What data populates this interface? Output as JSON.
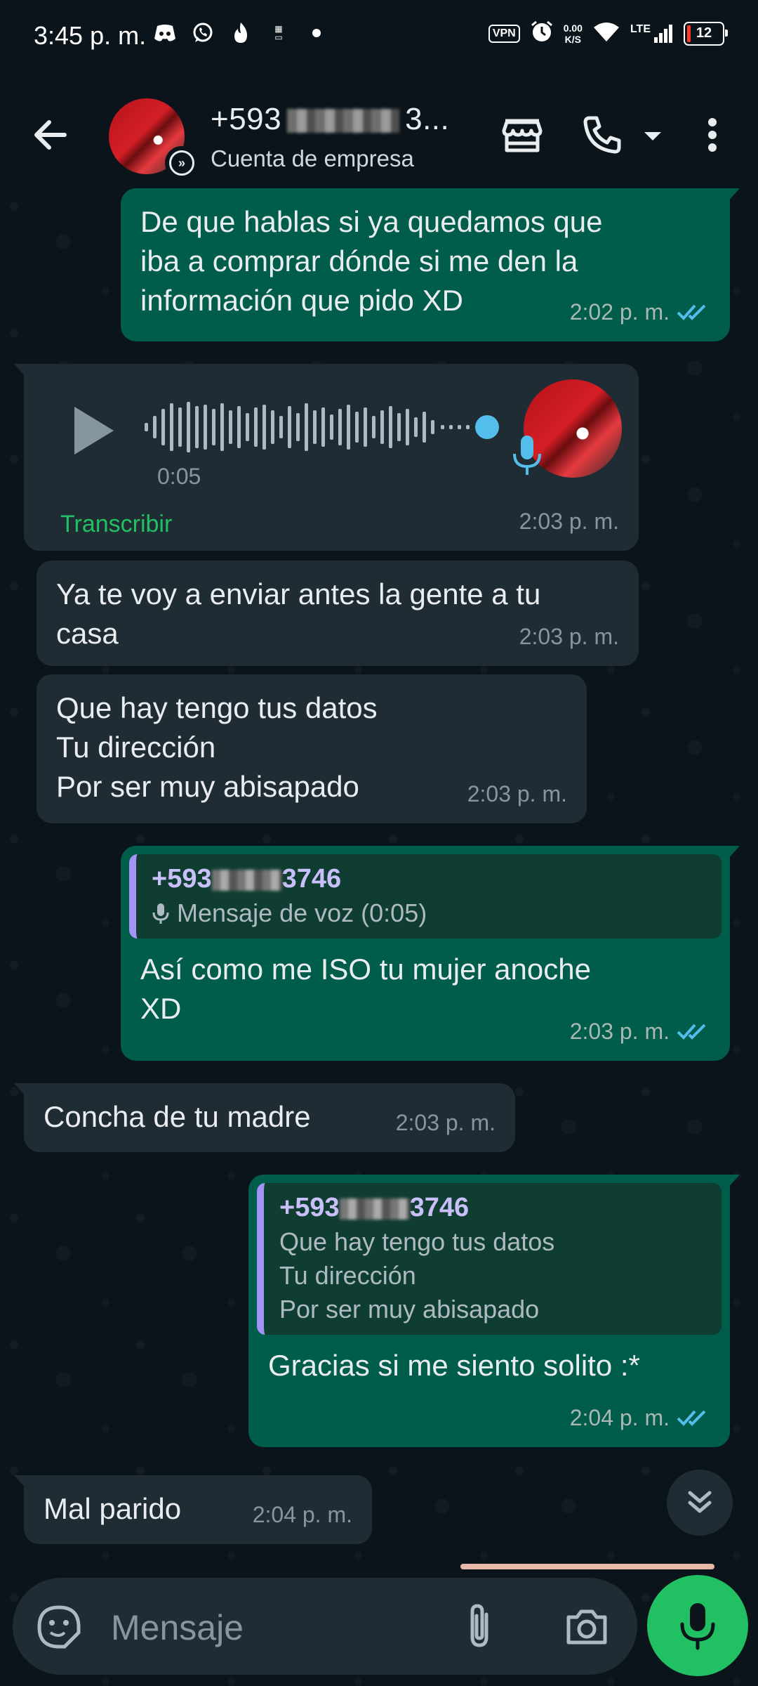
{
  "status_bar": {
    "time": "3:45 p. m.",
    "left_icons": [
      "discord-icon",
      "whatsapp-icon",
      "flame-icon",
      "temu-icon",
      "dot-icon"
    ],
    "vpn": "VPN",
    "speed_value": "0.00",
    "speed_unit": "K/S",
    "network": "LTE",
    "battery": "12"
  },
  "header": {
    "contact_name_prefix": "+593",
    "contact_name_suffix": "3...",
    "subtitle": "Cuenta de empresa"
  },
  "messages": [
    {
      "id": "m1",
      "direction": "out",
      "text_lines": [
        "De que hablas si ya quedamos que",
        "iba a comprar dónde si me den la",
        "información que pido XD"
      ],
      "time": "2:02 p. m.",
      "read": true
    },
    {
      "id": "m2",
      "direction": "in",
      "type": "voice",
      "duration": "0:05",
      "transcribe_label": "Transcribir",
      "time": "2:03 p. m."
    },
    {
      "id": "m3",
      "direction": "in",
      "text_lines": [
        "Ya te voy a enviar antes la gente a tu",
        "casa"
      ],
      "time": "2:03 p. m."
    },
    {
      "id": "m4",
      "direction": "in",
      "text_lines": [
        "Que hay tengo tus datos",
        "Tu dirección",
        "Por ser muy abisapado"
      ],
      "time": "2:03 p. m."
    },
    {
      "id": "m5",
      "direction": "out",
      "quote": {
        "name_prefix": "+593",
        "name_suffix": "3746",
        "text": "Mensaje de voz (0:05)"
      },
      "text_lines": [
        "Así como me ISO tu mujer anoche",
        "XD"
      ],
      "time": "2:03 p. m.",
      "read": true
    },
    {
      "id": "m6",
      "direction": "in",
      "text_lines": [
        "Concha de tu madre"
      ],
      "time": "2:03 p. m."
    },
    {
      "id": "m7",
      "direction": "out",
      "quote": {
        "name_prefix": "+593",
        "name_suffix": "3746",
        "text_lines": [
          "Que hay tengo tus datos",
          "Tu dirección",
          "Por ser muy abisapado"
        ]
      },
      "text_lines": [
        "Gracias si me siento solito :*"
      ],
      "time": "2:04 p. m.",
      "read": true
    },
    {
      "id": "m8",
      "direction": "in",
      "text_lines": [
        "Mal parido"
      ],
      "time": "2:04 p. m."
    }
  ],
  "input": {
    "placeholder": "Mensaje"
  },
  "colors": {
    "outgoing_bubble": "#005c4b",
    "incoming_bubble": "#202c33",
    "accent_green": "#21c063",
    "read_ticks": "#53bdeb",
    "quote_bar": "#a393f3"
  }
}
